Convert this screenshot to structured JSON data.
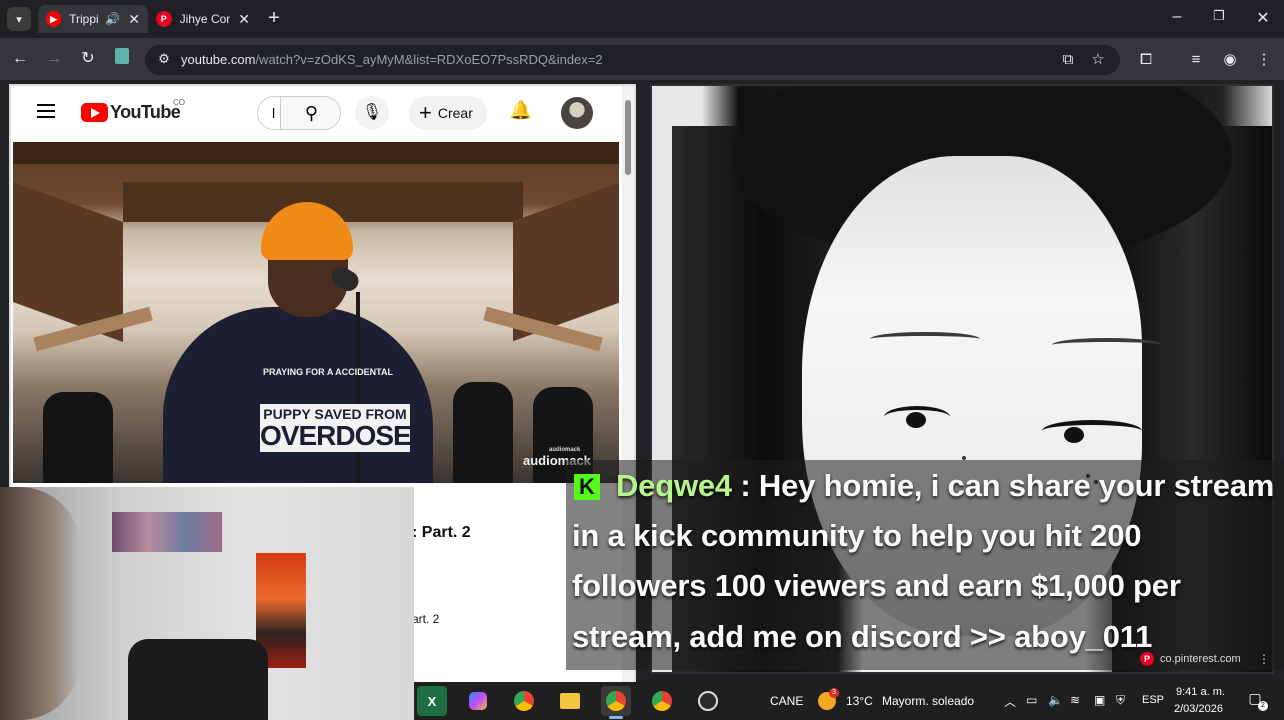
{
  "browser": {
    "tabs": [
      {
        "title": "Trippi",
        "favicon": "youtube-icon",
        "audio": true,
        "active": true
      },
      {
        "title": "Jihye Con",
        "favicon": "pinterest-icon",
        "audio": false,
        "active": false
      }
    ],
    "url_host": "youtube.com",
    "url_path": "/watch?v=zOdKS_ayMyM&list=RDXoEO7PssRDQ&index=2"
  },
  "youtube": {
    "logo_text": "YouTube",
    "country_code": "CO",
    "search_value": "l",
    "create_label": "Crear",
    "watermark": "audiomack",
    "watermark_sub": "audiomack",
    "hoodie_small": "PRAYING FOR A ACCIDENTAL",
    "hoodie_line1": "PUPPY SAVED FROM",
    "hoodie_line2": "OVERDOSE",
    "title_partial": ": Part. 2",
    "subtitle_partial": "art. 2"
  },
  "chat": {
    "platform_badge": "K",
    "username": "Deqwe4",
    "line1_rest": " : Hey homie, i can share your stream",
    "line2": "in a kick community to help you hit 200",
    "line3": "followers 100 viewers and earn $1,000 per",
    "line4": "stream, add me on discord >> aboy_011"
  },
  "pinterest": {
    "host": "co.pinterest.com"
  },
  "taskbar": {
    "tray_label": "CANE",
    "weather_temp": "13°C",
    "weather_desc": "Mayorm. soleado",
    "weather_badge": "3",
    "language": "ESP",
    "time": "9:41 a. m.",
    "date": "2/03/2026",
    "notification_count": "2"
  },
  "colors": {
    "youtube_red": "#ff0000",
    "kick_green": "#53fc18",
    "pinterest_red": "#e60023"
  }
}
